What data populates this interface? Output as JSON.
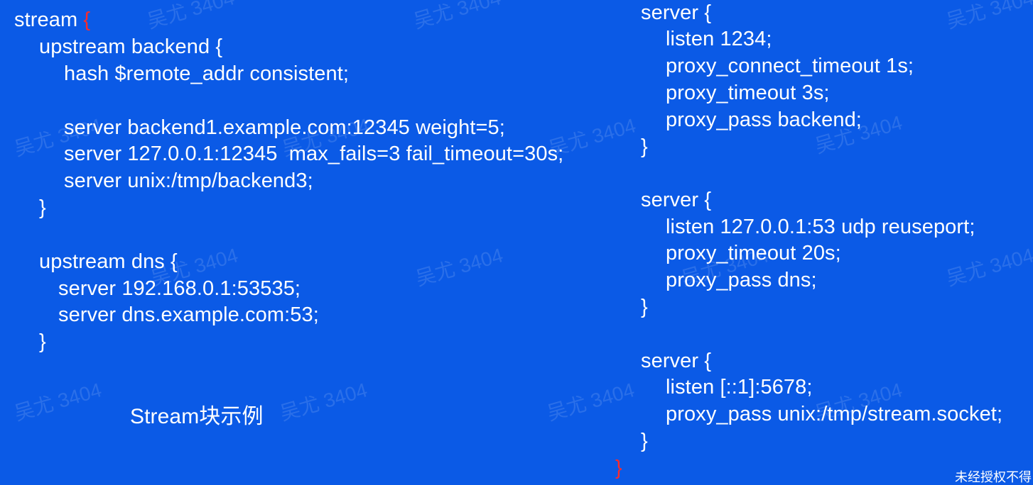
{
  "slide": {
    "left_code": {
      "stream_open": "stream ",
      "stream_brace": "{",
      "lines": [
        "upstream backend {",
        "hash $remote_addr consistent;",
        "server backend1.example.com:12345 weight=5;",
        "server 127.0.0.1:12345  max_fails=3 fail_timeout=30s;",
        "server unix:/tmp/backend3;",
        "}",
        "upstream dns {",
        "server 192.168.0.1:53535;",
        "server dns.example.com:53;",
        "}"
      ]
    },
    "caption": "Stream块示例",
    "right_code": {
      "lines": [
        "server {",
        "listen 1234;",
        "proxy_connect_timeout 1s;",
        "proxy_timeout 3s;",
        "proxy_pass backend;",
        "}",
        "server {",
        "listen 127.0.0.1:53 udp reuseport;",
        "proxy_timeout 20s;",
        "proxy_pass dns;",
        "}",
        "server {",
        "listen [::1]:5678;",
        "proxy_pass unix:/tmp/stream.socket;",
        "}"
      ],
      "closing_brace": "}"
    },
    "watermark": "吴尤 3404",
    "notice": "未经授权不得"
  },
  "colors": {
    "background": "#0b5ae6",
    "text": "#ffffff",
    "accent_brace": "#ff2a2a"
  }
}
